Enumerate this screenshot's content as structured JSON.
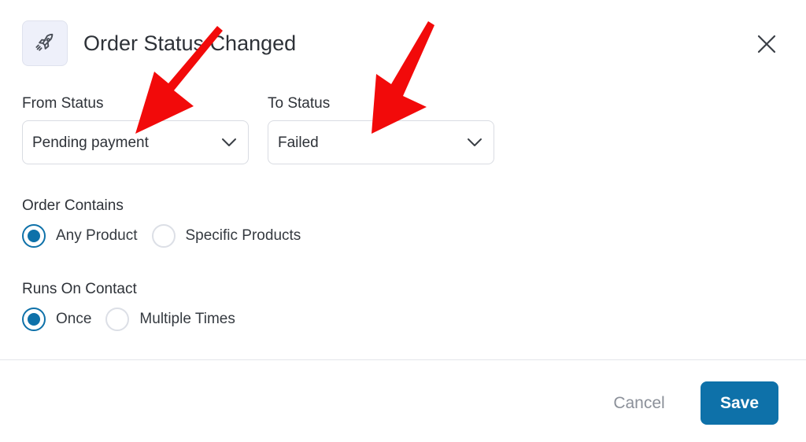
{
  "header": {
    "icon": "rocket-icon",
    "title": "Order Status Changed",
    "close_icon": "close-icon"
  },
  "from_status": {
    "label": "From Status",
    "selected": "Pending payment"
  },
  "to_status": {
    "label": "To Status",
    "selected": "Failed"
  },
  "order_contains": {
    "label": "Order Contains",
    "options": [
      {
        "label": "Any Product",
        "checked": true
      },
      {
        "label": "Specific Products",
        "checked": false
      }
    ]
  },
  "runs_on_contact": {
    "label": "Runs On Contact",
    "options": [
      {
        "label": "Once",
        "checked": true
      },
      {
        "label": "Multiple Times",
        "checked": false
      }
    ]
  },
  "footer": {
    "cancel_label": "Cancel",
    "save_label": "Save"
  },
  "annotations": {
    "arrow_color": "#f20a0a",
    "arrow_count": 2
  },
  "colors": {
    "primary": "#0e71a9",
    "text": "#2e3238",
    "muted": "#8b9099"
  }
}
